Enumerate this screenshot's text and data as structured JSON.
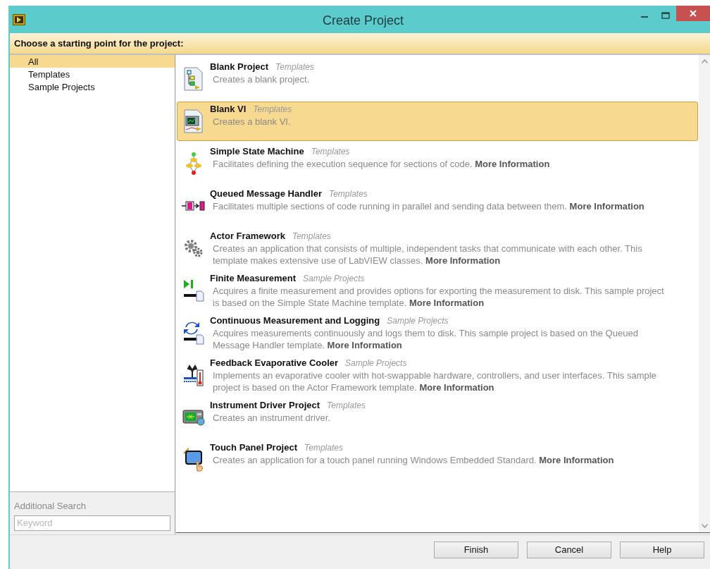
{
  "window": {
    "title": "Create Project"
  },
  "header": "Choose a starting point for the project:",
  "categories": [
    {
      "label": "All",
      "selected": true
    },
    {
      "label": "Templates",
      "selected": false
    },
    {
      "label": "Sample Projects",
      "selected": false
    }
  ],
  "search": {
    "label": "Additional Search",
    "placeholder": "Keyword"
  },
  "items": [
    {
      "title": "Blank Project",
      "category": "Templates",
      "description": "Creates a blank project.",
      "selected": false
    },
    {
      "title": "Blank VI",
      "category": "Templates",
      "description": "Creates a blank VI.",
      "selected": true
    },
    {
      "title": "Simple State Machine",
      "category": "Templates",
      "description": "Facilitates defining the execution sequence for sections of code.",
      "link": "More Information",
      "selected": false
    },
    {
      "title": "Queued Message Handler",
      "category": "Templates",
      "description": "Facilitates multiple sections of code running in parallel and sending data between them.",
      "link": "More Information",
      "selected": false
    },
    {
      "title": "Actor Framework",
      "category": "Templates",
      "description": "Creates an application that consists of multiple, independent tasks that communicate with each other. This template makes extensive use of LabVIEW classes.",
      "link": "More Information",
      "selected": false
    },
    {
      "title": "Finite Measurement",
      "category": "Sample Projects",
      "description": "Acquires a finite measurement and provides options for exporting the measurement to disk. This sample project is based on the Simple State Machine template.",
      "link": "More Information",
      "selected": false
    },
    {
      "title": "Continuous Measurement and Logging",
      "category": "Sample Projects",
      "description": "Acquires measurements continuously and logs them to disk. This sample project is based on the Queued Message Handler template.",
      "link": "More Information",
      "selected": false
    },
    {
      "title": "Feedback Evaporative Cooler",
      "category": "Sample Projects",
      "description": "Implements an evaporative cooler with hot-swappable hardware, controllers, and user interfaces. This sample project is based on the Actor Framework template.",
      "link": "More Information",
      "selected": false
    },
    {
      "title": "Instrument Driver Project",
      "category": "Templates",
      "description": "Creates an instrument driver.",
      "selected": false
    },
    {
      "title": "Touch Panel Project",
      "category": "Templates",
      "description": "Creates an application for a touch panel running Windows Embedded Standard.",
      "link": "More Information",
      "selected": false
    }
  ],
  "buttons": [
    "Finish",
    "Cancel",
    "Help"
  ]
}
